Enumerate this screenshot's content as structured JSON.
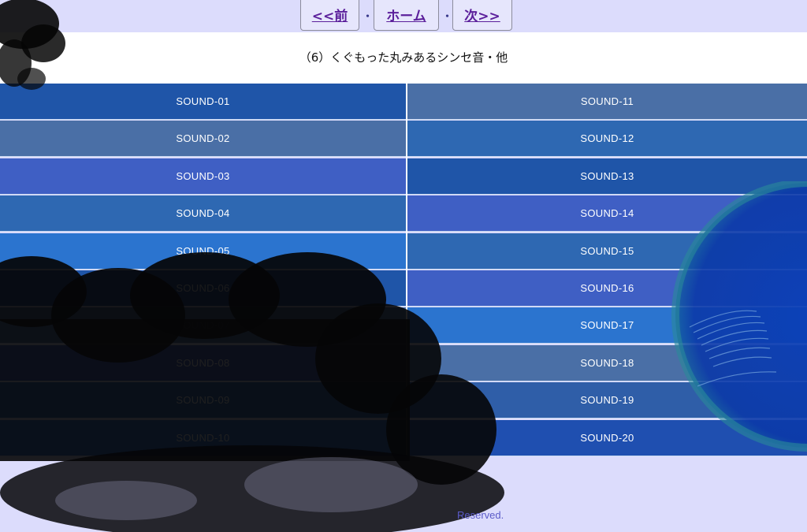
{
  "nav": {
    "prev_label": "<<前",
    "home_label": "ホーム",
    "next_label": "次>>",
    "separator": "・"
  },
  "page_title": "（6）くぐもった丸みあるシンセ音・他",
  "sounds_left": [
    {
      "label": "SOUND-01",
      "color": "#1f55a8"
    },
    {
      "label": "SOUND-02",
      "color": "#4a6fa6"
    },
    {
      "label": "SOUND-03",
      "color": "#3f5fc4"
    },
    {
      "label": "SOUND-04",
      "color": "#2e68b2"
    },
    {
      "label": "SOUND-05",
      "color": "#2b74cf"
    },
    {
      "label": "SOUND-06",
      "color": "#1f55a8"
    },
    {
      "label": "SOUND-07",
      "color": "#4a6fa6"
    },
    {
      "label": "SOUND-08",
      "color": "#3f5fc4"
    },
    {
      "label": "SOUND-09",
      "color": "#2e68b2"
    },
    {
      "label": "SOUND-10",
      "color": "#2b74cf"
    }
  ],
  "sounds_right": [
    {
      "label": "SOUND-11",
      "color": "#4a6fa6"
    },
    {
      "label": "SOUND-12",
      "color": "#2e68b2"
    },
    {
      "label": "SOUND-13",
      "color": "#1f55a8"
    },
    {
      "label": "SOUND-14",
      "color": "#3f5fc4"
    },
    {
      "label": "SOUND-15",
      "color": "#2e68b2"
    },
    {
      "label": "SOUND-16",
      "color": "#3f5fc4"
    },
    {
      "label": "SOUND-17",
      "color": "#2b74cf"
    },
    {
      "label": "SOUND-18",
      "color": "#4a6fa6"
    },
    {
      "label": "SOUND-19",
      "color": "#2f5ea8"
    },
    {
      "label": "SOUND-20",
      "color": "#1f4fb0"
    }
  ],
  "footer": {
    "line1": "",
    "line2": "Reserved."
  },
  "colors": {
    "page_bg": "#dcdcfc",
    "nav_text": "#5b1f9b",
    "footer_text": "#5a5ac8"
  }
}
